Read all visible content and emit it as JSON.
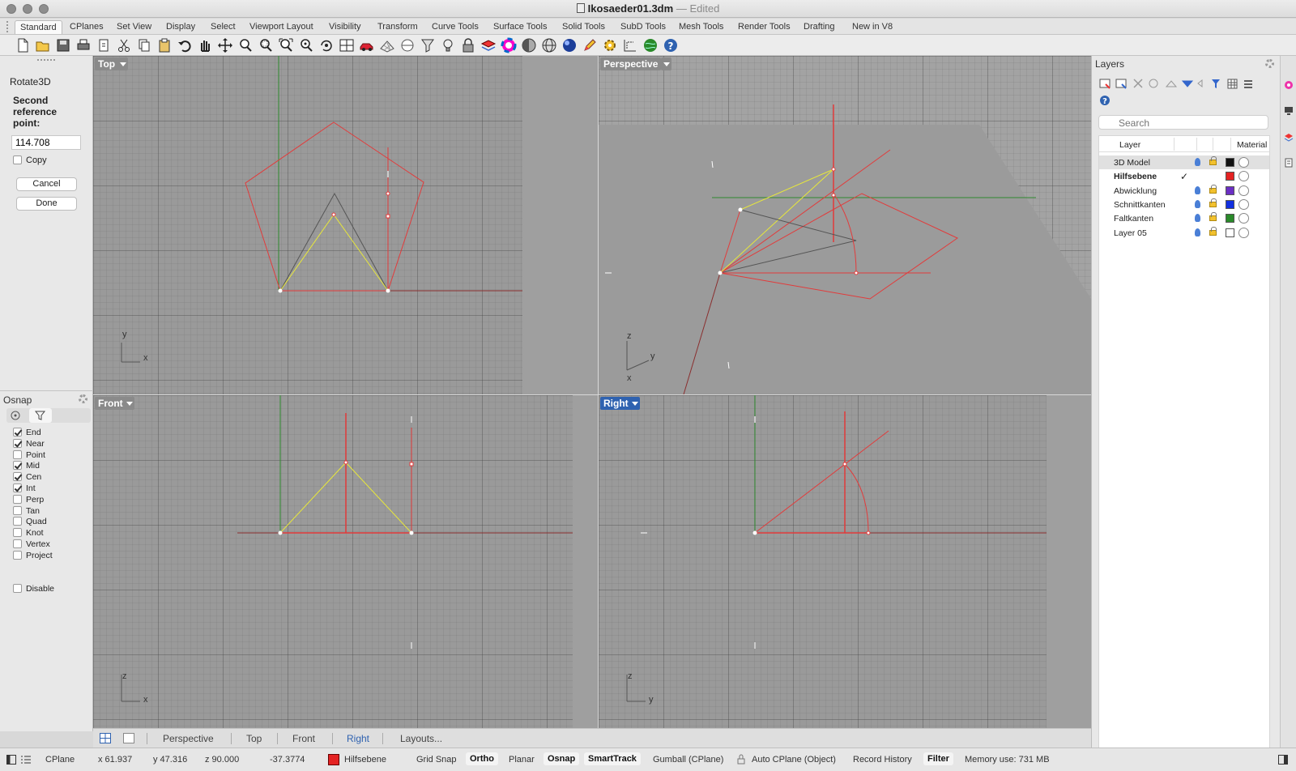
{
  "window": {
    "filename": "Ikosaeder01.3dm",
    "separator": "—",
    "status": "Edited"
  },
  "toolbar_tabs": [
    "Standard",
    "CPlanes",
    "Set View",
    "Display",
    "Select",
    "Viewport Layout",
    "Visibility",
    "Transform",
    "Curve Tools",
    "Surface Tools",
    "Solid Tools",
    "SubD Tools",
    "Mesh Tools",
    "Render Tools",
    "Drafting",
    "New in V8"
  ],
  "command": {
    "name": "Rotate3D",
    "prompt": "Second reference point:",
    "input_value": "114.708",
    "copy_label": "Copy",
    "cancel_label": "Cancel",
    "done_label": "Done"
  },
  "osnap": {
    "title": "Osnap",
    "items": [
      {
        "label": "End",
        "checked": true
      },
      {
        "label": "Near",
        "checked": true
      },
      {
        "label": "Point",
        "checked": false
      },
      {
        "label": "Mid",
        "checked": true
      },
      {
        "label": "Cen",
        "checked": true
      },
      {
        "label": "Int",
        "checked": true
      },
      {
        "label": "Perp",
        "checked": false
      },
      {
        "label": "Tan",
        "checked": false
      },
      {
        "label": "Quad",
        "checked": false
      },
      {
        "label": "Knot",
        "checked": false
      },
      {
        "label": "Vertex",
        "checked": false
      },
      {
        "label": "Project",
        "checked": false
      }
    ],
    "disable_label": "Disable"
  },
  "viewports": {
    "top": {
      "label": "Top",
      "axis1": "y",
      "axis2": "x"
    },
    "perspective": {
      "label": "Perspective",
      "axis1": "z",
      "axis2": "y",
      "axis3": "x"
    },
    "front": {
      "label": "Front",
      "axis1": "z",
      "axis2": "x"
    },
    "right": {
      "label": "Right",
      "axis1": "z",
      "axis2": "y"
    }
  },
  "viewport_tabs": [
    "Perspective",
    "Top",
    "Front",
    "Right",
    "Layouts..."
  ],
  "layers": {
    "title": "Layers",
    "search_placeholder": "Search",
    "col_layer": "Layer",
    "col_material": "Material",
    "rows": [
      {
        "name": "3D Model",
        "color": "#111111",
        "current": false
      },
      {
        "name": "Hilfsebene",
        "color": "#e42222",
        "current": true,
        "check": "✓"
      },
      {
        "name": "Abwicklung",
        "color": "#6b2fc4",
        "current": false
      },
      {
        "name": "Schnittkanten",
        "color": "#1230e0",
        "current": false
      },
      {
        "name": "Faltkanten",
        "color": "#2a8a2a",
        "current": false
      },
      {
        "name": "Layer 05",
        "color": "#ffffff",
        "current": false
      }
    ]
  },
  "status": {
    "cplane": "CPlane",
    "x": "x 61.937",
    "y": "y 47.316",
    "z": "z 90.000",
    "dist": "-37.3774",
    "layer_color": "#e42222",
    "layer": "Hilfsebene",
    "grid_snap": "Grid Snap",
    "ortho": "Ortho",
    "planar": "Planar",
    "osnap": "Osnap",
    "smarttrack": "SmartTrack",
    "gumball": "Gumball (CPlane)",
    "auto_cplane": "Auto CPlane (Object)",
    "record_history": "Record History",
    "filter": "Filter",
    "memory": "Memory use: 731 MB"
  }
}
